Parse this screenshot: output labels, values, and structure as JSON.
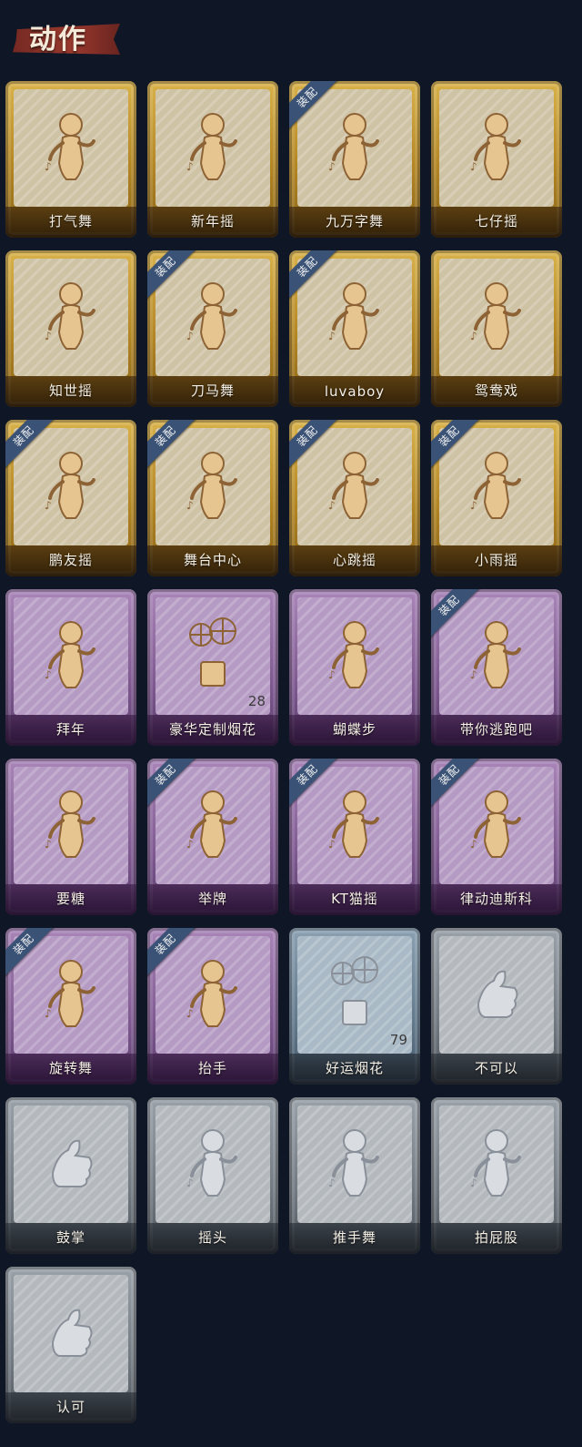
{
  "header": {
    "title": "动作"
  },
  "equip_badge": "装配",
  "items": [
    {
      "label": "打气舞",
      "tier": "gold",
      "equipped": false,
      "count": "",
      "icon": "dance-pose-icon"
    },
    {
      "label": "新年摇",
      "tier": "gold",
      "equipped": false,
      "count": "",
      "icon": "dance-pose-icon"
    },
    {
      "label": "九万字舞",
      "tier": "gold",
      "equipped": true,
      "count": "",
      "icon": "dance-pose-icon"
    },
    {
      "label": "七仔摇",
      "tier": "gold",
      "equipped": false,
      "count": "",
      "icon": "dance-pose-icon"
    },
    {
      "label": "知世摇",
      "tier": "gold",
      "equipped": false,
      "count": "",
      "icon": "dance-pose-icon"
    },
    {
      "label": "刀马舞",
      "tier": "gold",
      "equipped": true,
      "count": "",
      "icon": "dance-pose-icon"
    },
    {
      "label": "luvaboy",
      "tier": "gold",
      "equipped": true,
      "count": "",
      "icon": "dance-pose-icon"
    },
    {
      "label": "鸳鸯戏",
      "tier": "gold",
      "equipped": false,
      "count": "",
      "icon": "dance-pose-icon"
    },
    {
      "label": "鹏友摇",
      "tier": "gold",
      "equipped": true,
      "count": "",
      "icon": "dance-pose-icon"
    },
    {
      "label": "舞台中心",
      "tier": "gold",
      "equipped": true,
      "count": "",
      "icon": "dance-pose-icon"
    },
    {
      "label": "心跳摇",
      "tier": "gold",
      "equipped": true,
      "count": "",
      "icon": "dance-pose-icon"
    },
    {
      "label": "小雨摇",
      "tier": "gold",
      "equipped": true,
      "count": "",
      "icon": "dance-pose-icon"
    },
    {
      "label": "拜年",
      "tier": "purple",
      "equipped": false,
      "count": "",
      "icon": "greeting-pose-icon"
    },
    {
      "label": "豪华定制烟花",
      "tier": "purple",
      "equipped": false,
      "count": "28",
      "icon": "firework-box-icon"
    },
    {
      "label": "蝴蝶步",
      "tier": "purple",
      "equipped": false,
      "count": "",
      "icon": "dance-pose-icon"
    },
    {
      "label": "带你逃跑吧",
      "tier": "purple",
      "equipped": true,
      "count": "",
      "icon": "dance-pose-icon"
    },
    {
      "label": "要糖",
      "tier": "purple",
      "equipped": false,
      "count": "",
      "icon": "reach-pose-icon"
    },
    {
      "label": "举牌",
      "tier": "purple",
      "equipped": true,
      "count": "",
      "icon": "sign-pose-icon"
    },
    {
      "label": "KT猫摇",
      "tier": "purple",
      "equipped": true,
      "count": "",
      "icon": "dance-pose-icon"
    },
    {
      "label": "律动迪斯科",
      "tier": "purple",
      "equipped": true,
      "count": "",
      "icon": "disco-pose-icon"
    },
    {
      "label": "旋转舞",
      "tier": "purple",
      "equipped": true,
      "count": "",
      "icon": "spin-pose-icon"
    },
    {
      "label": "抬手",
      "tier": "purple",
      "equipped": true,
      "count": "",
      "icon": "raise-hand-pose-icon"
    },
    {
      "label": "好运烟花",
      "tier": "blue",
      "equipped": false,
      "count": "79",
      "icon": "firework-can-icon"
    },
    {
      "label": "不可以",
      "tier": "gray",
      "equipped": false,
      "count": "",
      "icon": "finger-wag-icon"
    },
    {
      "label": "鼓掌",
      "tier": "gray",
      "equipped": false,
      "count": "",
      "icon": "clap-hands-icon"
    },
    {
      "label": "摇头",
      "tier": "gray",
      "equipped": false,
      "count": "",
      "icon": "shake-head-pose-icon"
    },
    {
      "label": "推手舞",
      "tier": "gray",
      "equipped": false,
      "count": "",
      "icon": "push-hands-pose-icon"
    },
    {
      "label": "拍屁股",
      "tier": "gray",
      "equipped": false,
      "count": "",
      "icon": "spank-pose-icon"
    },
    {
      "label": "认可",
      "tier": "gray",
      "equipped": false,
      "count": "",
      "icon": "thumbs-up-icon"
    }
  ]
}
